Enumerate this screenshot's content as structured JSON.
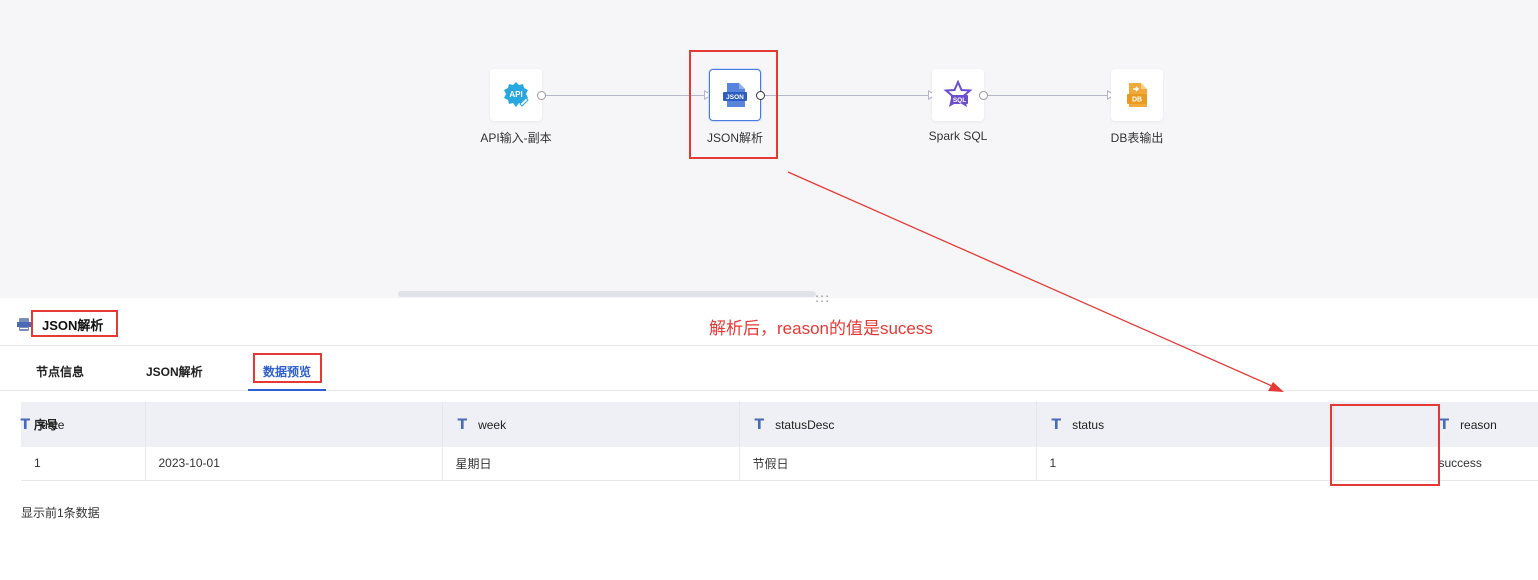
{
  "flow": {
    "nodes": [
      {
        "label": "API输入-副本",
        "badge": "API"
      },
      {
        "label": "JSON解析",
        "badge": "JSON"
      },
      {
        "label": "Spark SQL",
        "badge": "SQL"
      },
      {
        "label": "DB表输出",
        "badge": "DB"
      }
    ],
    "resize_grip": ":::"
  },
  "panel": {
    "title": "JSON解析",
    "annotation": "解析后，reason的值是sucess"
  },
  "tabs": [
    {
      "label": "节点信息"
    },
    {
      "label": "JSON解析"
    },
    {
      "label": "数据预览",
      "active": true
    }
  ],
  "table": {
    "type_icon": "T",
    "columns": [
      "序号",
      "date",
      "week",
      "statusDesc",
      "status",
      "reason"
    ],
    "rows": [
      [
        "1",
        "2023-10-01",
        "星期日",
        "节假日",
        "1",
        "success"
      ]
    ]
  },
  "footer_note": "显示前1条数据",
  "colors": {
    "annotation_red": "#e53935",
    "accent_blue": "#2f5fd0",
    "api_icon": "#29a8e0",
    "json_icon": "#3b6fd6",
    "sql_icon": "#6b4fd0",
    "db_icon": "#f2a93b"
  }
}
